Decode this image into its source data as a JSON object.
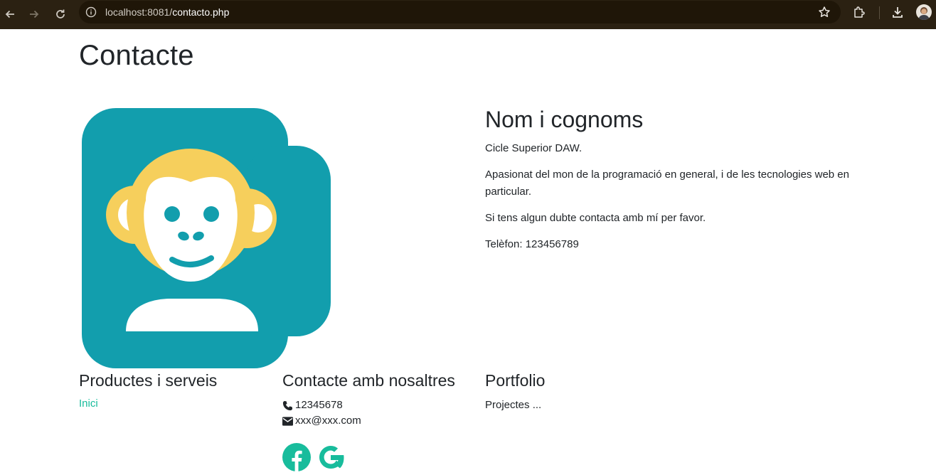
{
  "browser": {
    "url_host": "localhost:8081/",
    "url_path": "contacto.php",
    "icons": [
      "back-arrow-icon",
      "forward-arrow-icon",
      "reload-icon",
      "info-icon",
      "star-icon",
      "extensions-icon",
      "download-icon"
    ]
  },
  "page": {
    "title": "Contacte"
  },
  "profile": {
    "name": "Nom i cognoms",
    "lines": [
      "Cicle Superior DAW.",
      "Apasionat del mon de la programació en general, i de les tecnologies web en particular.",
      "Si tens algun dubte contacta amb mí per favor.",
      "Telèfon: 123456789"
    ],
    "avatar_icon": "monkey-avatar-icon"
  },
  "footer": {
    "products": {
      "heading": "Productes i serveis",
      "link": "Inici"
    },
    "contact": {
      "heading": "Contacte amb nosaltres",
      "phone": "12345678",
      "email": "xxx@xxx.com",
      "socials": [
        "facebook-icon",
        "google-icon"
      ]
    },
    "portfolio": {
      "heading": "Portfolio",
      "text": "Projectes ..."
    }
  },
  "colors": {
    "accent": "#18bc9c",
    "avatar_bg": "#129ead",
    "avatar_face": "#f6cf5c",
    "text": "#212529"
  }
}
